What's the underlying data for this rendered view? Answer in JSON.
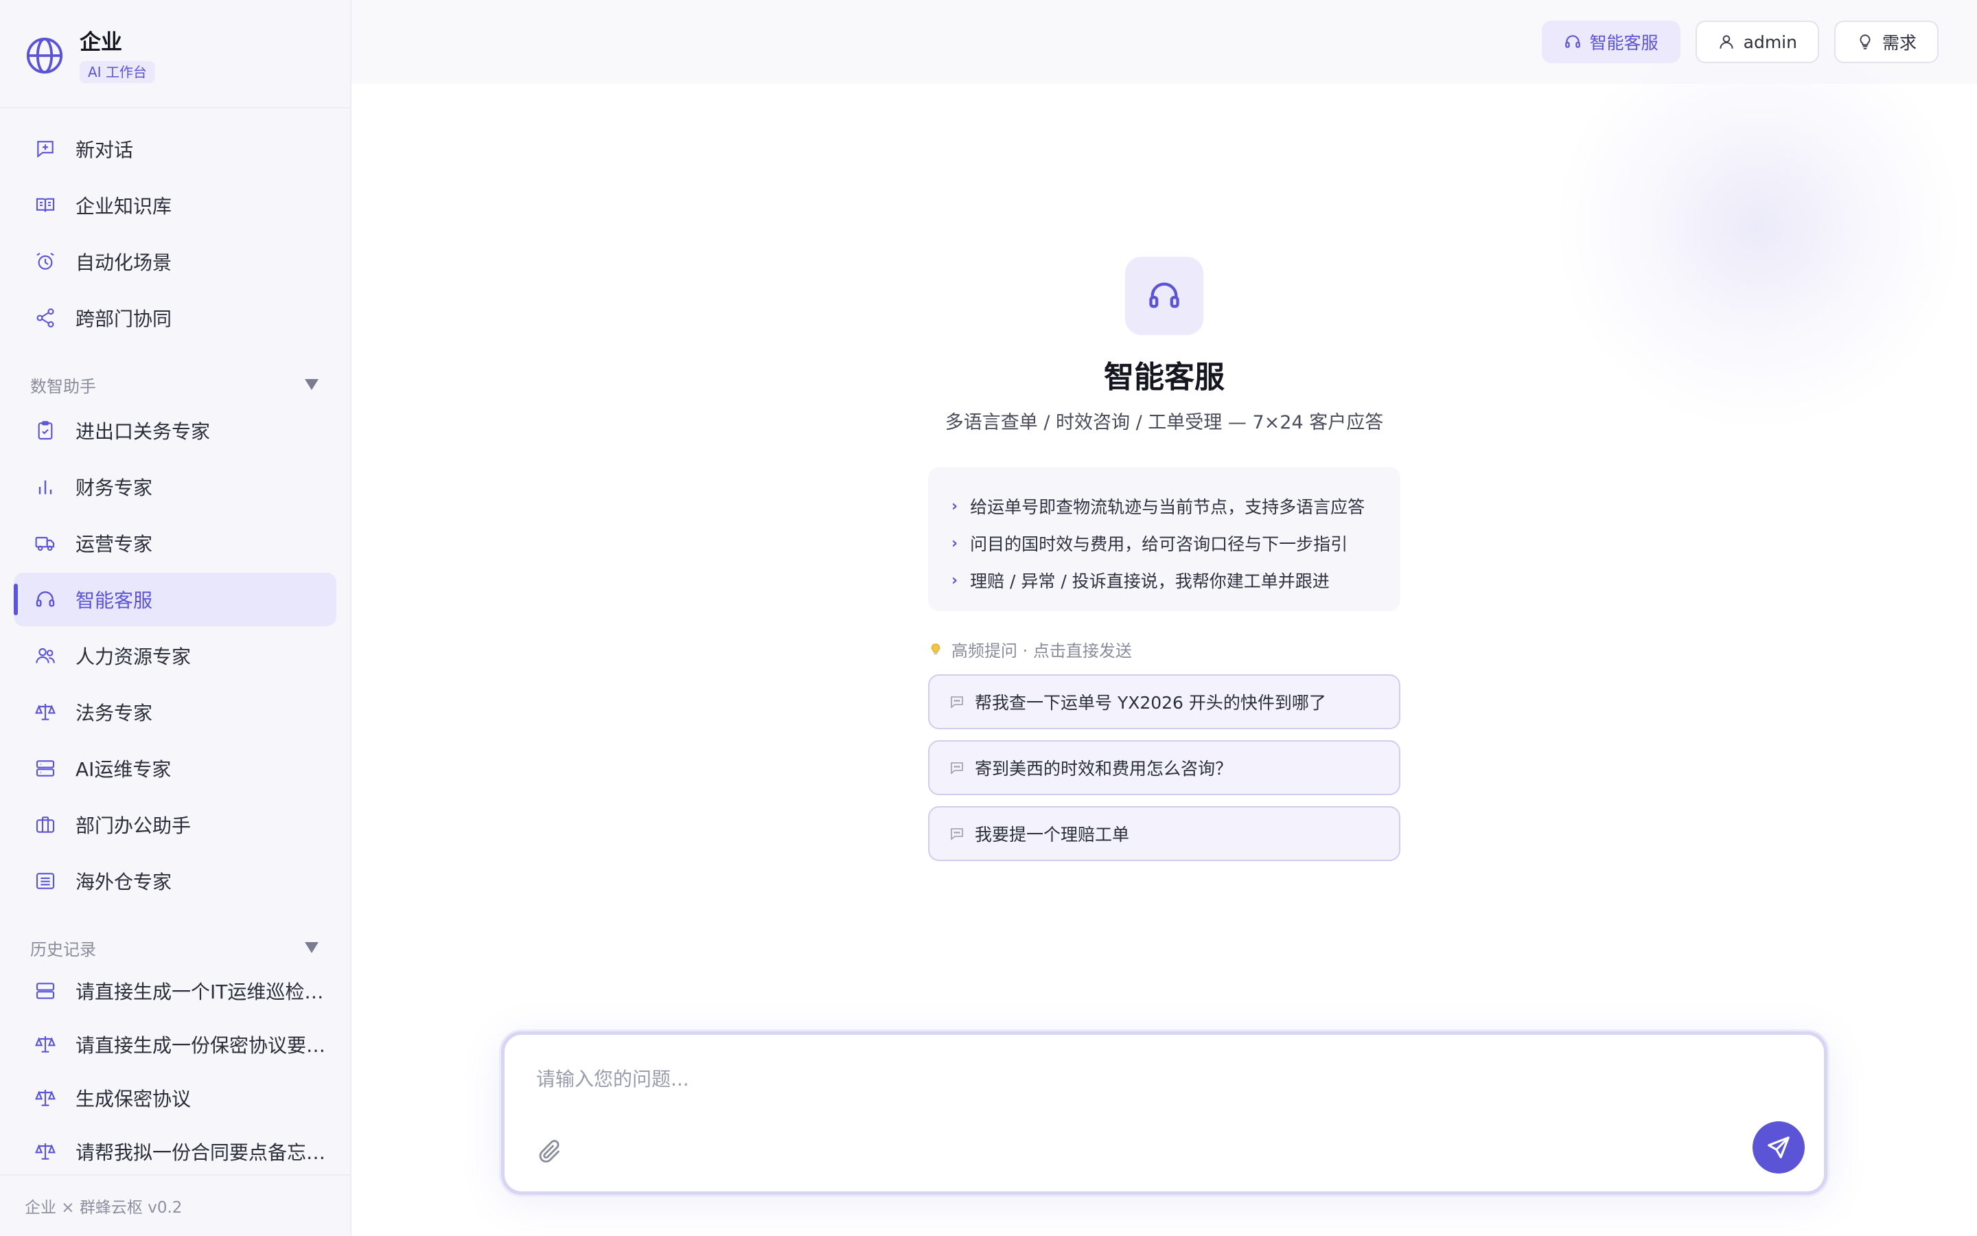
{
  "brand": {
    "name": "企业",
    "tag": "AI 工作台"
  },
  "nav": [
    {
      "label": "新对话",
      "icon": "new-chat-icon"
    },
    {
      "label": "企业知识库",
      "icon": "book-icon"
    },
    {
      "label": "自动化场景",
      "icon": "alarm-clock-icon"
    },
    {
      "label": "跨部门协同",
      "icon": "share-icon"
    }
  ],
  "assistants": {
    "title": "数智助手",
    "items": [
      {
        "label": "进出口关务专家",
        "icon": "clipboard-check-icon"
      },
      {
        "label": "财务专家",
        "icon": "bar-chart-icon"
      },
      {
        "label": "运营专家",
        "icon": "truck-icon"
      },
      {
        "label": "智能客服",
        "icon": "headset-icon",
        "active": true
      },
      {
        "label": "人力资源专家",
        "icon": "users-icon"
      },
      {
        "label": "法务专家",
        "icon": "scale-icon"
      },
      {
        "label": "AI运维专家",
        "icon": "server-icon"
      },
      {
        "label": "部门办公助手",
        "icon": "briefcase-icon"
      },
      {
        "label": "海外仓专家",
        "icon": "warehouse-icon"
      }
    ]
  },
  "history": {
    "title": "历史记录",
    "items": [
      {
        "label": "请直接生成一个IT运维巡检清...",
        "icon": "server-icon"
      },
      {
        "label": "请直接生成一份保密协议要点...",
        "icon": "scale-icon"
      },
      {
        "label": "生成保密协议",
        "icon": "scale-icon"
      },
      {
        "label": "请帮我拟一份合同要点备忘录...",
        "icon": "scale-icon"
      }
    ]
  },
  "footer": "企业 × 群蜂云枢 v0.2",
  "topbar": {
    "current": "智能客服",
    "user": "admin",
    "requirement": "需求"
  },
  "hero": {
    "title": "智能客服",
    "subtitle": "多语言查单 / 时效咨询 / 工单受理 — 7×24 客户应答",
    "tips": [
      "给运单号即查物流轨迹与当前节点，支持多语言应答",
      "问目的国时效与费用，给可咨询口径与下一步指引",
      "理赔 / 异常 / 投诉直接说，我帮你建工单并跟进"
    ]
  },
  "faq": {
    "title": "高频提问 · 点击直接发送",
    "items": [
      "帮我查一下运单号 YX2026 开头的快件到哪了",
      "寄到美西的时效和费用怎么咨询？",
      "我要提一个理赔工单"
    ]
  },
  "composer": {
    "placeholder": "请输入您的问题..."
  },
  "colors": {
    "accent": "#5b54d6",
    "accent_soft": "#e9e7fb"
  }
}
